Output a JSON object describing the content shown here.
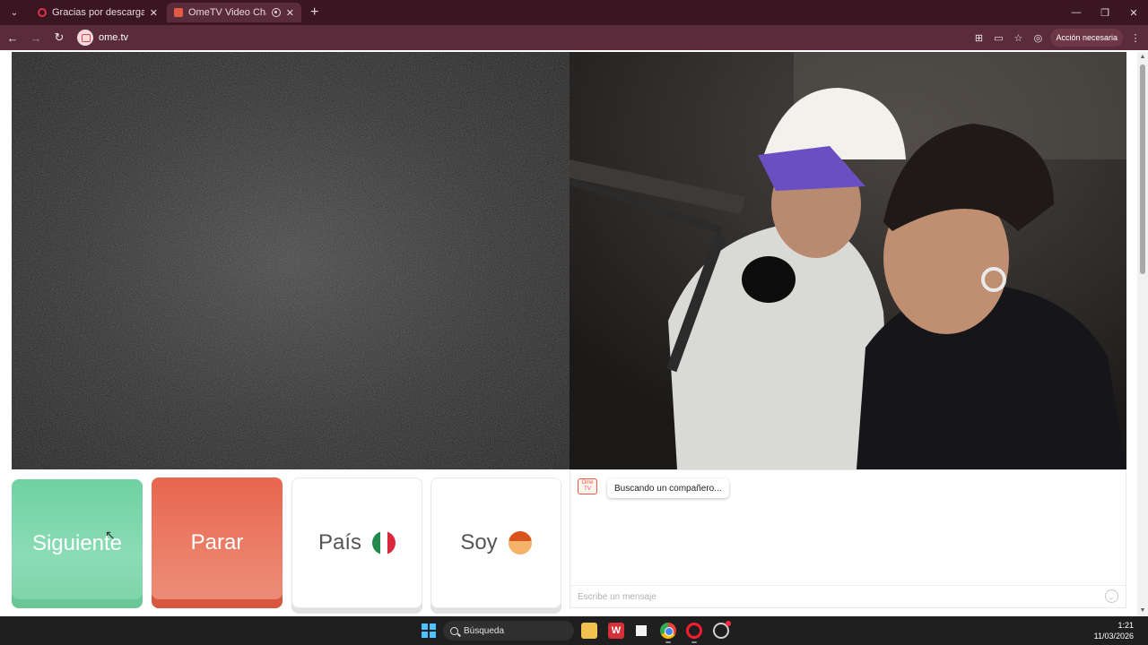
{
  "browser": {
    "tabs": [
      {
        "title": "Gracias por descargar Opera",
        "active": false
      },
      {
        "title": "OmeTV Video Chat — Ome",
        "active": true
      }
    ],
    "url": "ome.tv",
    "action_label": "Acción necesaria"
  },
  "controls": {
    "next_label": "Siguiente",
    "stop_label": "Parar",
    "country_label": "País",
    "gender_label": "Soy"
  },
  "chat": {
    "logo_text": "Ome TV",
    "status_message": "Buscando un compañero...",
    "input_placeholder": "Escribe un mensaje"
  },
  "taskbar": {
    "search_label": "Búsqueda",
    "time": "1:21",
    "date": "11/03/2026"
  },
  "icons": [
    "menu-icon",
    "opera-favicon-icon",
    "ometv-favicon-icon",
    "recording-icon",
    "close-icon",
    "plus-icon",
    "minimize-icon",
    "maximize-icon",
    "back-icon",
    "forward-icon",
    "reload-icon",
    "translate-icon",
    "cast-icon",
    "star-icon",
    "profile-icon",
    "kebab-menu-icon",
    "mexico-flag-icon",
    "boy-avatar-icon",
    "emoji-icon",
    "windows-start-icon",
    "search-icon"
  ],
  "colors": {
    "tabstrip_bg": "#3a1622",
    "addressbar_bg": "#5a2b3a",
    "next_button": "#7cd3a7",
    "stop_button": "#e8664e"
  }
}
